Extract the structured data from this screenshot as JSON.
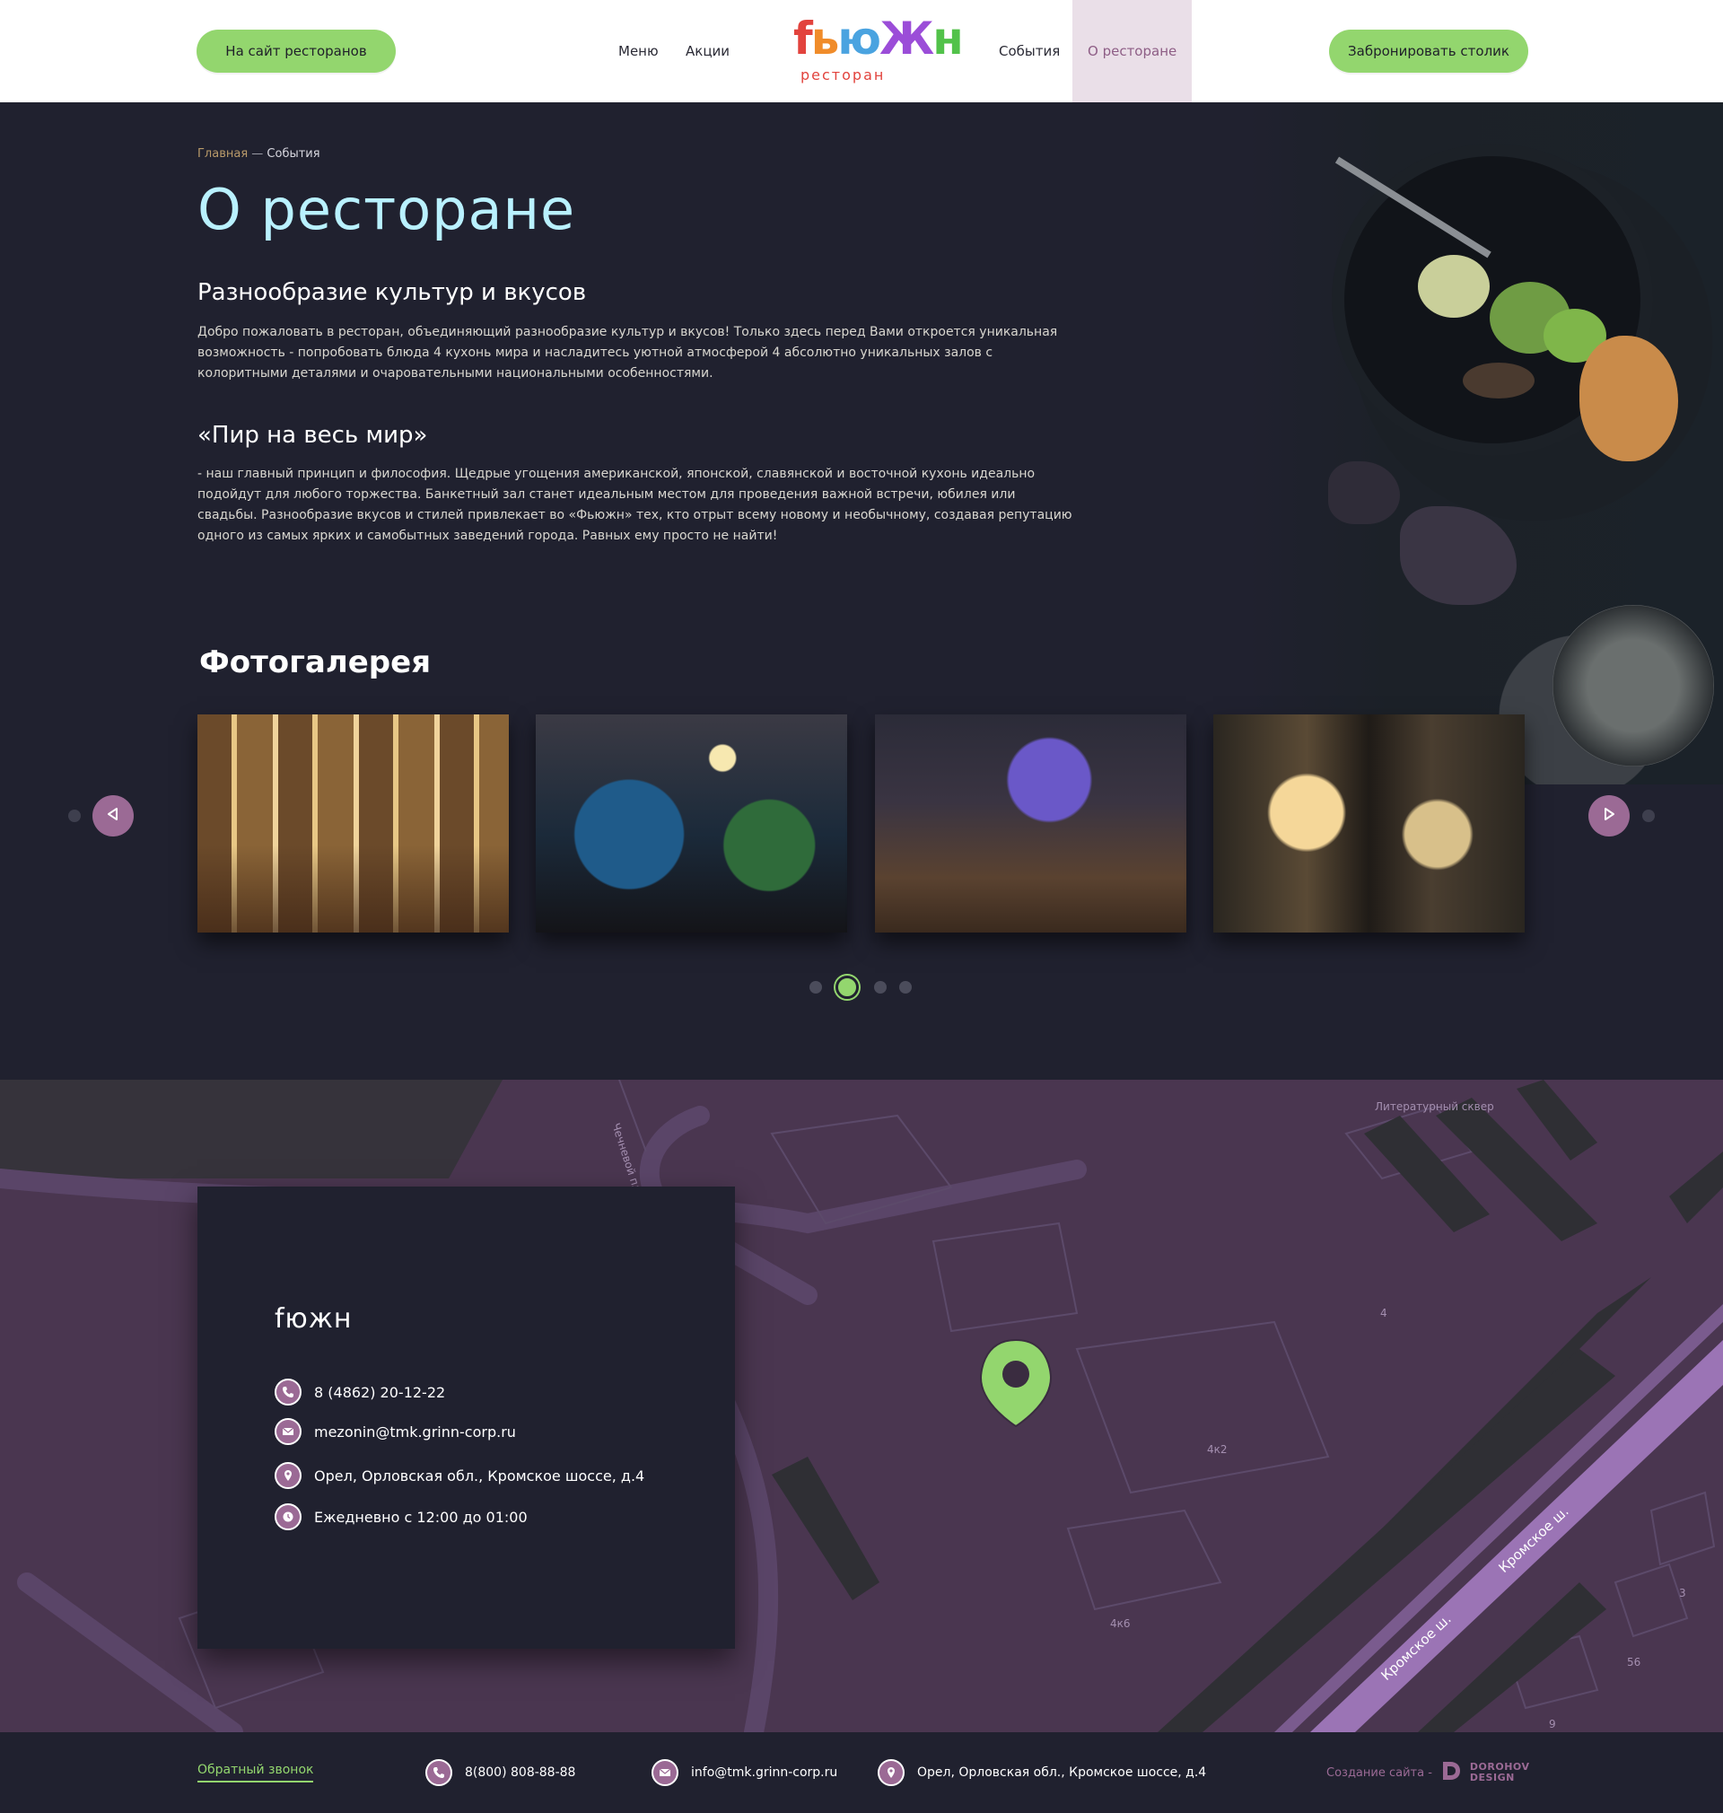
{
  "colors": {
    "accent_green": "#93d66e",
    "accent_purple": "#9b6a95",
    "bg_dark": "#20212f",
    "title_cyan": "#b9f1ff",
    "map_purple": "#4a3650"
  },
  "header": {
    "sites_button": "На сайт ресторанов",
    "nav": [
      {
        "label": "Меню"
      },
      {
        "label": "Акции"
      },
      {
        "label": "События"
      },
      {
        "label": "О ресторане",
        "active": true
      }
    ],
    "logo": {
      "word": "fьюЖн",
      "sub": "ресторан"
    },
    "book_button": "Забронировать столик"
  },
  "hero": {
    "breadcrumb": {
      "home": "Главная",
      "sep": " — ",
      "current": "События"
    },
    "title": "О ресторане",
    "sections": [
      {
        "heading": "Разнообразие культур и вкусов",
        "text": "Добро пожаловать в ресторан, объединяющий разнообразие культур и вкусов! Только здесь перед Вами откроется уникальная возможность - попробовать блюда 4 кухонь мира и насладитесь уютной атмосферой 4 абсолютно уникальных залов с колоритными деталями и очаровательными национальными особенностями."
      },
      {
        "heading": "«Пир на весь мир»",
        "text": "- наш главный принцип и философия. Щедрые угощения американской, японской, славянской и восточной кухонь идеально подойдут для любого торжества. Банкетный зал станет идеальным местом для проведения важной встречи, юбилея или свадьбы. Разнообразие вкусов и стилей привлекает во «Фьюжн» тех, кто отрыт всему новому и необычному, создавая репутацию одного из самых ярких и самобытных заведений города. Равных ему просто не найти!"
      }
    ]
  },
  "gallery": {
    "title": "Фотогалерея",
    "prev_icon": "triangle-left-icon",
    "next_icon": "triangle-right-icon",
    "pager": {
      "count": 4,
      "active_index": 1
    }
  },
  "map": {
    "labels": {
      "park": "Литературный сквер",
      "street_vertical": "Чечневой пл",
      "street_main_1": "Кромское ш.",
      "street_main_2": "Кромское ш.",
      "b4": "4",
      "b4k2": "4к2",
      "b4k6": "4к6",
      "b3": "3",
      "b56": "56",
      "b9": "9"
    },
    "pin_icon": "map-pin-icon"
  },
  "contact": {
    "logo": "fюжн",
    "phone": "8 (4862) 20-12-22",
    "email": "mezonin@tmk.grinn-corp.ru",
    "address": "Орел, Орловская обл., Кромское шоссе, д.4",
    "hours": "Ежедневно с 12:00 до 01:00"
  },
  "footer": {
    "callback": "Обратный звонок",
    "phone": "8(800) 808-88-88",
    "email": "info@tmk.grinn-corp.ru",
    "address": "Орел, Орловская обл., Кромское шоссе, д.4",
    "credit": "Создание сайта -",
    "brand_line1": "DOROHOV",
    "brand_line2": "DESIGN"
  }
}
